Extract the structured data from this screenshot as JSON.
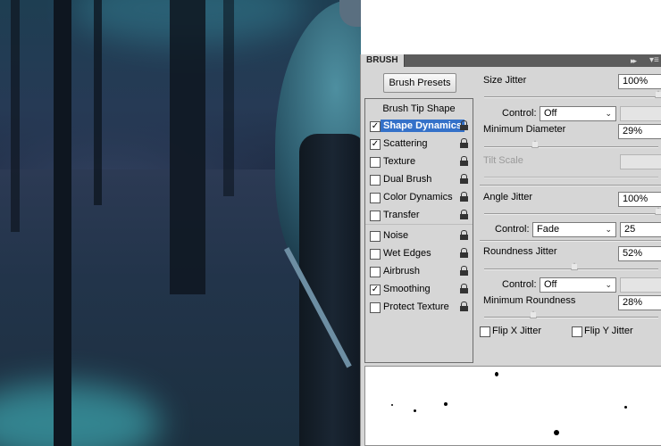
{
  "panel": {
    "tab_title": "BRUSH",
    "collapse_glyph": "▸▸",
    "menu_glyph": "▾≡",
    "presets_button": "Brush Presets",
    "tip_shape_label": "Brush Tip Shape",
    "options": [
      {
        "label": "Shape Dynamics",
        "checked": true,
        "selected": true
      },
      {
        "label": "Scattering",
        "checked": true,
        "selected": false
      },
      {
        "label": "Texture",
        "checked": false,
        "selected": false
      },
      {
        "label": "Dual Brush",
        "checked": false,
        "selected": false
      },
      {
        "label": "Color Dynamics",
        "checked": false,
        "selected": false
      },
      {
        "label": "Transfer",
        "checked": false,
        "selected": false
      },
      {
        "label": "Noise",
        "checked": false,
        "selected": false
      },
      {
        "label": "Wet Edges",
        "checked": false,
        "selected": false
      },
      {
        "label": "Airbrush",
        "checked": false,
        "selected": false
      },
      {
        "label": "Smoothing",
        "checked": true,
        "selected": false
      },
      {
        "label": "Protect Texture",
        "checked": false,
        "selected": false
      }
    ],
    "check_glyph": "✓"
  },
  "dynamics": {
    "size_jitter_label": "Size Jitter",
    "size_jitter_value": "100%",
    "size_jitter_level": 1.0,
    "control_label": "Control:",
    "size_control": "Off",
    "min_diameter_label": "Minimum Diameter",
    "min_diameter_value": "29%",
    "min_diameter_level": 0.29,
    "tilt_scale_label": "Tilt Scale",
    "angle_jitter_label": "Angle Jitter",
    "angle_jitter_value": "100%",
    "angle_jitter_level": 1.0,
    "angle_control": "Fade",
    "angle_fade_steps": "25",
    "roundness_jitter_label": "Roundness Jitter",
    "roundness_jitter_value": "52%",
    "roundness_jitter_level": 0.52,
    "roundness_control": "Off",
    "min_roundness_label": "Minimum Roundness",
    "min_roundness_value": "28%",
    "min_roundness_level": 0.28,
    "flip_x_label": "Flip X Jitter",
    "flip_y_label": "Flip Y Jitter",
    "flip_x_checked": false,
    "flip_y_checked": false,
    "dropdown_glyph": "⌄"
  },
  "colors": {
    "selection": "#3471c9",
    "panel_bg": "#d6d6d6"
  }
}
